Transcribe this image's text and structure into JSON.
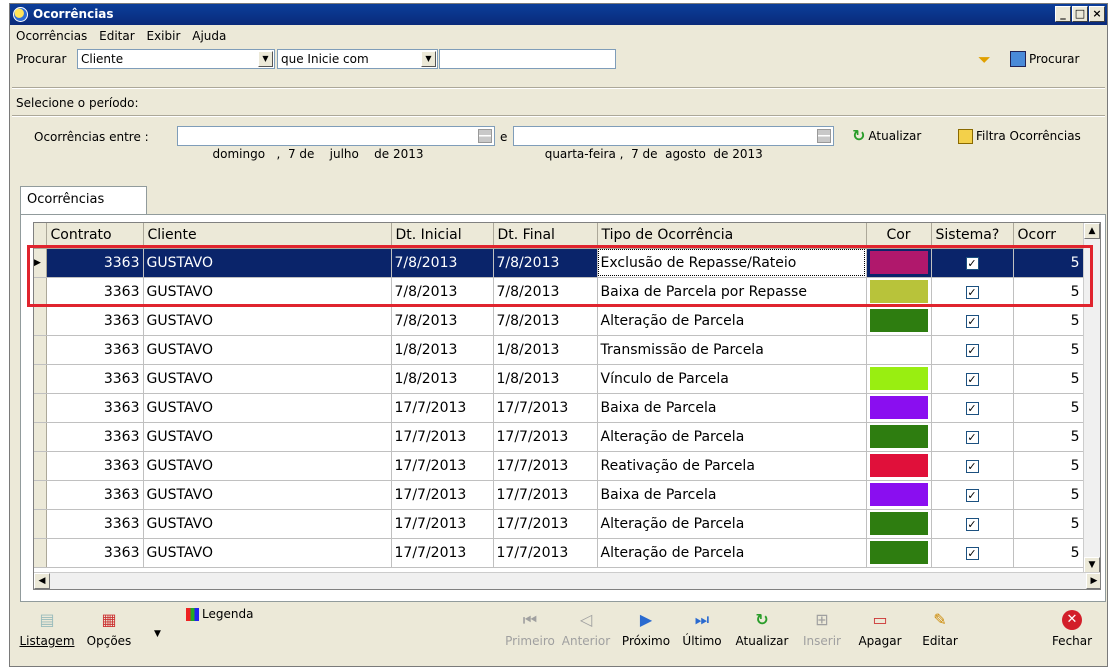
{
  "window": {
    "title": "Ocorrências"
  },
  "menu": [
    "Ocorrências",
    "Editar",
    "Exibir",
    "Ajuda"
  ],
  "search": {
    "label": "Procurar",
    "field_value": "Cliente",
    "mode_value": "que Inicie com",
    "text_value": "",
    "button": "Procurar"
  },
  "period": {
    "heading": "Selecione o período:",
    "label": "Ocorrências entre :",
    "start": "  domingo   ,  7 de    julho    de 2013",
    "conj": "e",
    "end": " quarta-feira ,  7 de  agosto  de 2013",
    "refresh_button": "Atualizar",
    "filter_button": "Filtra Ocorrências"
  },
  "tab": "Ocorrências",
  "grid": {
    "columns": [
      "Contrato",
      "Cliente",
      "Dt. Inicial",
      "Dt. Final",
      "Tipo de Ocorrência",
      "Cor",
      "Sistema?",
      "Ocorr"
    ],
    "rows": [
      {
        "contrato": "3363",
        "cliente": "GUSTAVO",
        "inicio": "7/8/2013",
        "fim": "7/8/2013",
        "tipo": "Exclusão de Repasse/Rateio",
        "cor": "#b0186c",
        "sistema": "✓",
        "ocorr": "5"
      },
      {
        "contrato": "3363",
        "cliente": "GUSTAVO",
        "inicio": "7/8/2013",
        "fim": "7/8/2013",
        "tipo": "Baixa de Parcela por Repasse",
        "cor": "#b8c33a",
        "sistema": "✓",
        "ocorr": "5"
      },
      {
        "contrato": "3363",
        "cliente": "GUSTAVO",
        "inicio": "7/8/2013",
        "fim": "7/8/2013",
        "tipo": "Alteração de Parcela",
        "cor": "#2e7d10",
        "sistema": "✓",
        "ocorr": "5"
      },
      {
        "contrato": "3363",
        "cliente": "GUSTAVO",
        "inicio": "1/8/2013",
        "fim": "1/8/2013",
        "tipo": "Transmissão de Parcela",
        "cor": "#ffffff",
        "sistema": "✓",
        "ocorr": "5"
      },
      {
        "contrato": "3363",
        "cliente": "GUSTAVO",
        "inicio": "1/8/2013",
        "fim": "1/8/2013",
        "tipo": "Vínculo de Parcela",
        "cor": "#99ee11",
        "sistema": "✓",
        "ocorr": "5"
      },
      {
        "contrato": "3363",
        "cliente": "GUSTAVO",
        "inicio": "17/7/2013",
        "fim": "17/7/2013",
        "tipo": "Baixa de Parcela",
        "cor": "#8a0ef0",
        "sistema": "✓",
        "ocorr": "5"
      },
      {
        "contrato": "3363",
        "cliente": "GUSTAVO",
        "inicio": "17/7/2013",
        "fim": "17/7/2013",
        "tipo": "Alteração de Parcela",
        "cor": "#2e7d10",
        "sistema": "✓",
        "ocorr": "5"
      },
      {
        "contrato": "3363",
        "cliente": "GUSTAVO",
        "inicio": "17/7/2013",
        "fim": "17/7/2013",
        "tipo": "Reativação de Parcela",
        "cor": "#e0103a",
        "sistema": "✓",
        "ocorr": "5"
      },
      {
        "contrato": "3363",
        "cliente": "GUSTAVO",
        "inicio": "17/7/2013",
        "fim": "17/7/2013",
        "tipo": "Baixa de Parcela",
        "cor": "#8a0ef0",
        "sistema": "✓",
        "ocorr": "5"
      },
      {
        "contrato": "3363",
        "cliente": "GUSTAVO",
        "inicio": "17/7/2013",
        "fim": "17/7/2013",
        "tipo": "Alteração de Parcela",
        "cor": "#2e7d10",
        "sistema": "✓",
        "ocorr": "5"
      },
      {
        "contrato": "3363",
        "cliente": "GUSTAVO",
        "inicio": "17/7/2013",
        "fim": "17/7/2013",
        "tipo": "Alteração de Parcela",
        "cor": "#2e7d10",
        "sistema": "✓",
        "ocorr": "5"
      }
    ]
  },
  "toolbar": {
    "listagem": "Listagem",
    "opcoes": "Opções",
    "legenda": "Legenda",
    "primeiro": "Primeiro",
    "anterior": "Anterior",
    "proximo": "Próximo",
    "ultimo": "Último",
    "atualizar": "Atualizar",
    "inserir": "Inserir",
    "apagar": "Apagar",
    "editar": "Editar",
    "fechar": "Fechar"
  }
}
